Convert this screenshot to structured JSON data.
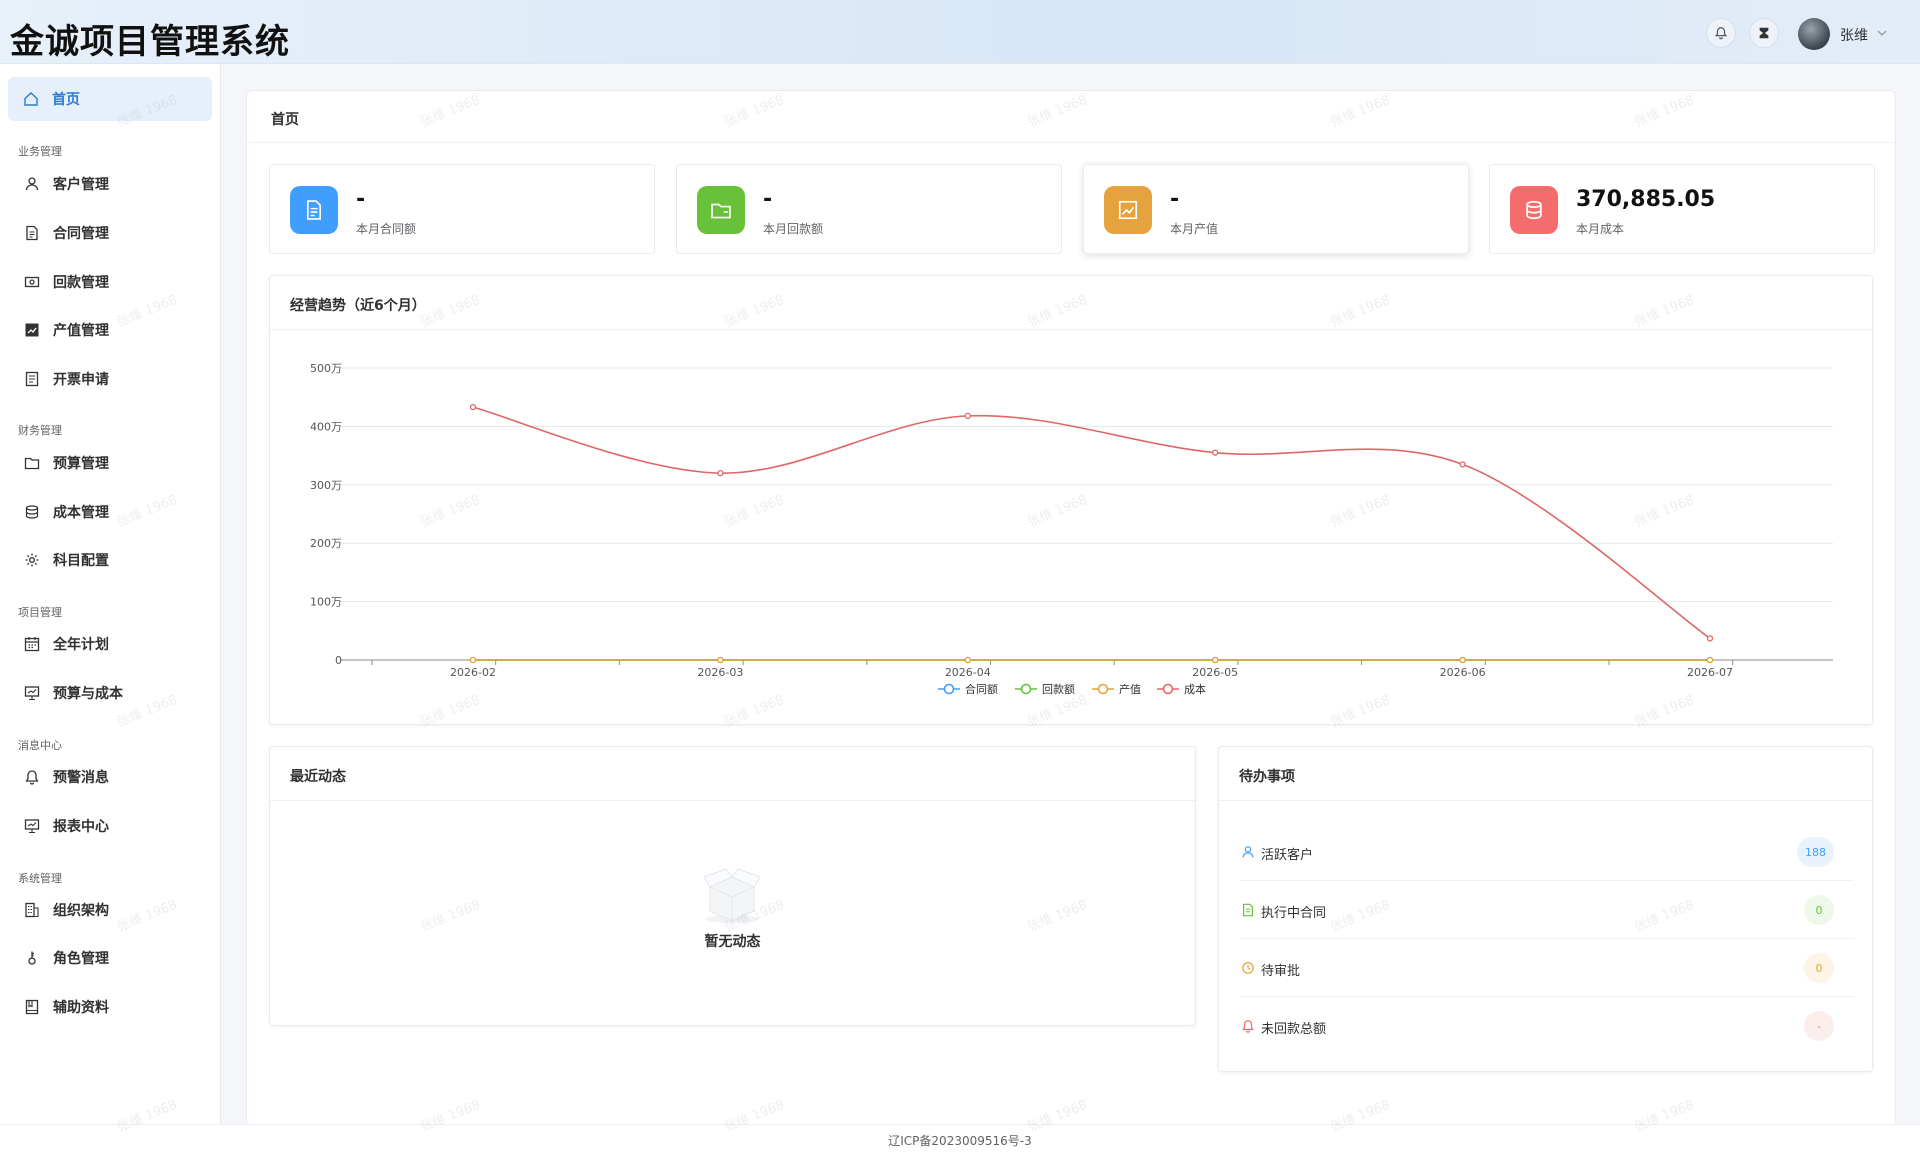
{
  "header": {
    "app_title": "金诚项目管理系统",
    "user_name": "张维"
  },
  "sidebar": {
    "home": "首页",
    "groups": [
      {
        "title": "业务管理",
        "items": [
          "客户管理",
          "合同管理",
          "回款管理",
          "产值管理",
          "开票申请"
        ]
      },
      {
        "title": "财务管理",
        "items": [
          "预算管理",
          "成本管理",
          "科目配置"
        ]
      },
      {
        "title": "项目管理",
        "items": [
          "全年计划",
          "预算与成本"
        ]
      },
      {
        "title": "消息中心",
        "items": [
          "预警消息",
          "报表中心"
        ]
      },
      {
        "title": "系统管理",
        "items": [
          "组织架构",
          "角色管理",
          "辅助资料"
        ]
      }
    ]
  },
  "page": {
    "title": "首页"
  },
  "stats": [
    {
      "value": "-",
      "label": "本月合同额",
      "color": "#409eff",
      "icon": "document-icon"
    },
    {
      "value": "-",
      "label": "本月回款额",
      "color": "#67c23a",
      "icon": "wallet-icon"
    },
    {
      "value": "-",
      "label": "本月产值",
      "color": "#e6a23c",
      "icon": "trend-icon"
    },
    {
      "value": "370,885.05",
      "label": "本月成本",
      "color": "#f56c6c",
      "icon": "database-icon"
    }
  ],
  "trend_panel": {
    "title": "经营趋势（近6个月）"
  },
  "chart_data": {
    "type": "line",
    "title": "经营趋势（近6个月）",
    "categories": [
      "2026-02",
      "2026-03",
      "2026-04",
      "2026-05",
      "2026-06",
      "2026-07"
    ],
    "y_ticks": [
      "0",
      "100万",
      "200万",
      "300万",
      "400万",
      "500万"
    ],
    "ylim": [
      0,
      500
    ],
    "yunit": "万",
    "legend_position": "bottom",
    "series": [
      {
        "name": "合同额",
        "color": "#409eff",
        "values": [
          0,
          0,
          0,
          0,
          0,
          0
        ]
      },
      {
        "name": "回款额",
        "color": "#67c23a",
        "values": [
          0,
          0,
          0,
          0,
          0,
          0
        ]
      },
      {
        "name": "产值",
        "color": "#e6a23c",
        "values": [
          0,
          0,
          0,
          0,
          0,
          0
        ]
      },
      {
        "name": "成本",
        "color": "#e06666",
        "values": [
          433,
          320,
          418,
          355,
          335,
          37
        ]
      }
    ]
  },
  "recent_panel": {
    "title": "最近动态",
    "empty_text": "暂无动态"
  },
  "todo_panel": {
    "title": "待办事项",
    "items": [
      {
        "label": "活跃客户",
        "count": "188",
        "icon": "user-icon",
        "color": "#409eff",
        "bg": "#e8f2fd"
      },
      {
        "label": "执行中合同",
        "count": "0",
        "icon": "document-icon",
        "color": "#67c23a",
        "bg": "#eef8e8"
      },
      {
        "label": "待审批",
        "count": "0",
        "icon": "clock-icon",
        "color": "#e6a23c",
        "bg": "#fcf4e6"
      },
      {
        "label": "未回款总额",
        "count": "-",
        "icon": "bell-icon",
        "color": "#f56c6c",
        "bg": "#fdeeee"
      }
    ]
  },
  "footer": {
    "icp": "辽ICP备2023009516号-3"
  },
  "watermark": "张维 1968"
}
